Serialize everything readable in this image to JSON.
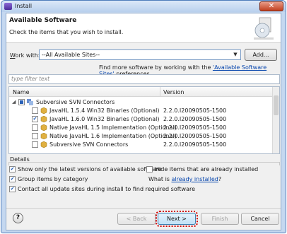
{
  "window": {
    "title": "Install",
    "close_glyph": "✕"
  },
  "banner": {
    "title": "Available Software",
    "description": "Check the items that you wish to install."
  },
  "workwith": {
    "label_prefix": "W",
    "label_rest": "ork with:",
    "value": "--All Available Sites--",
    "add_label": "Add..."
  },
  "more": {
    "prefix": "Find more software by working with the ",
    "link": "'Available Software Sites'",
    "suffix": " preferences."
  },
  "filter": {
    "placeholder": "type filter text"
  },
  "table": {
    "headers": {
      "name": "Name",
      "version": "Version"
    },
    "rows": [
      {
        "name": "Subversive SVN Connectors",
        "version": "",
        "checked": "partial",
        "expanded": true,
        "level": 0
      },
      {
        "name": "JavaHL 1.5.4 Win32 Binaries (Optional)",
        "version": "2.2.0.I20090505-1500",
        "checked": false,
        "level": 1
      },
      {
        "name": "JavaHL 1.6.0 Win32 Binaries (Optional)",
        "version": "2.2.0.I20090505-1500",
        "checked": true,
        "level": 1
      },
      {
        "name": "Native JavaHL 1.5 Implementation (Optional)",
        "version": "2.2.0.I20090505-1500",
        "checked": false,
        "level": 1
      },
      {
        "name": "Native JavaHL 1.6 Implementation (Optional)",
        "version": "2.2.0.I20090505-1500",
        "checked": false,
        "level": 1
      },
      {
        "name": "Subversive SVN Connectors",
        "version": "2.2.0.I20090505-1500",
        "checked": false,
        "level": 1
      }
    ]
  },
  "details": {
    "label": "Details"
  },
  "options": {
    "latest": "Show only the latest versions of available software",
    "hide_installed": "Hide items that are already installed",
    "group": "Group items by category",
    "what_is_prefix": "What is ",
    "what_is_link": "already installed",
    "what_is_suffix": "?",
    "contact": "Contact all update sites during install to find required software"
  },
  "buttons": {
    "help": "?",
    "back": "< Back",
    "next": "Next >",
    "finish": "Finish",
    "cancel": "Cancel"
  },
  "colors": {
    "link": "#0645ad",
    "focus_outline": "#d00000"
  }
}
